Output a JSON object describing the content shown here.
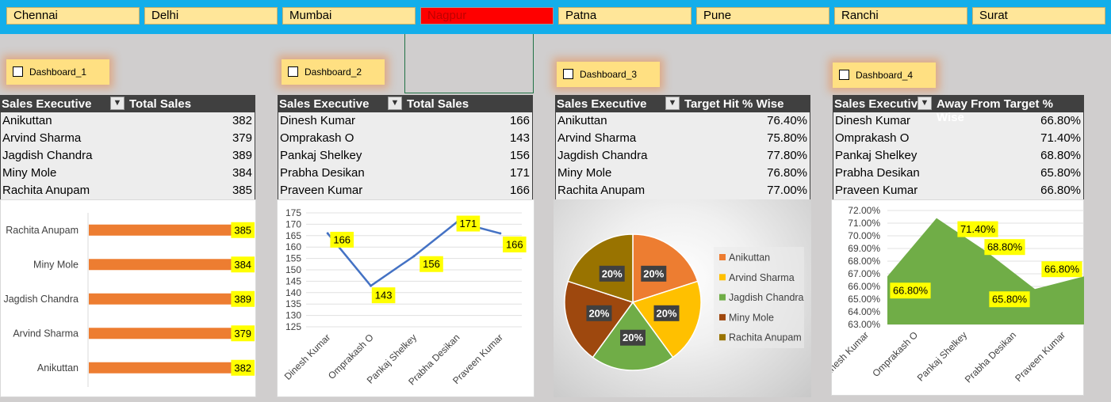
{
  "slicer": {
    "items": [
      "Chennai",
      "Delhi",
      "Mumbai",
      "Nagpur",
      "Patna",
      "Pune",
      "Ranchi",
      "Surat"
    ],
    "selected": "Nagpur"
  },
  "checkboxes": [
    "Dashboard_1",
    "Dashboard_2",
    "Dashboard_3",
    "Dashboard_4"
  ],
  "tables": [
    {
      "col1": "Sales Executive",
      "col2": "Total Sales",
      "rows": [
        [
          "Anikuttan",
          "382"
        ],
        [
          "Arvind Sharma",
          "379"
        ],
        [
          "Jagdish Chandra",
          "389"
        ],
        [
          "Miny Mole",
          "384"
        ],
        [
          "Rachita Anupam",
          "385"
        ]
      ]
    },
    {
      "col1": "Sales Executive",
      "col2": "Total Sales",
      "rows": [
        [
          "Dinesh Kumar",
          "166"
        ],
        [
          "Omprakash O",
          "143"
        ],
        [
          "Pankaj Shelkey",
          "156"
        ],
        [
          "Prabha Desikan",
          "171"
        ],
        [
          "Praveen Kumar",
          "166"
        ]
      ]
    },
    {
      "col1": "Sales Executive",
      "col2": "Target Hit % Wise",
      "rows": [
        [
          "Anikuttan",
          "76.40%"
        ],
        [
          "Arvind Sharma",
          "75.80%"
        ],
        [
          "Jagdish Chandra",
          "77.80%"
        ],
        [
          "Miny Mole",
          "76.80%"
        ],
        [
          "Rachita Anupam",
          "77.00%"
        ]
      ]
    },
    {
      "col1": "Sales Executive",
      "col2": "Away From Target % Wise",
      "rows": [
        [
          "Dinesh Kumar",
          "66.80%"
        ],
        [
          "Omprakash O",
          "71.40%"
        ],
        [
          "Pankaj Shelkey",
          "68.80%"
        ],
        [
          "Prabha Desikan",
          "65.80%"
        ],
        [
          "Praveen Kumar",
          "66.80%"
        ]
      ]
    }
  ],
  "colors": {
    "orange": "#ed7d31",
    "blue": "#4472c4",
    "green": "#70ad47",
    "gold": "#ffc000",
    "rust": "#9e480e",
    "olive": "#997300",
    "label_bg": "#ffff00",
    "header_bg": "#404040"
  },
  "chart_data": [
    {
      "type": "bar",
      "orientation": "horizontal",
      "categories": [
        "Rachita Anupam",
        "Miny Mole",
        "Jagdish Chandra",
        "Arvind Sharma",
        "Anikuttan"
      ],
      "values": [
        385,
        384,
        389,
        379,
        382
      ],
      "data_labels": [
        "385",
        "384",
        "389",
        "379",
        "382"
      ],
      "xlim": [
        0,
        389
      ]
    },
    {
      "type": "line",
      "categories": [
        "Dinesh Kumar",
        "Omprakash O",
        "Pankaj Shelkey",
        "Prabha Desikan",
        "Praveen Kumar"
      ],
      "values": [
        166,
        143,
        156,
        171,
        166
      ],
      "data_labels": [
        "166",
        "143",
        "156",
        "171",
        "166"
      ],
      "ylim": [
        125,
        175
      ],
      "yticks": [
        "175",
        "170",
        "165",
        "160",
        "155",
        "150",
        "145",
        "140",
        "135",
        "130",
        "125"
      ]
    },
    {
      "type": "pie",
      "categories": [
        "Anikuttan",
        "Arvind Sharma",
        "Jagdish Chandra",
        "Miny Mole",
        "Rachita Anupam"
      ],
      "values": [
        20,
        20,
        20,
        20,
        20
      ],
      "data_labels": [
        "20%",
        "20%",
        "20%",
        "20%",
        "20%"
      ],
      "legend": "right"
    },
    {
      "type": "area",
      "categories": [
        "Dinesh Kumar",
        "Omprakash O",
        "Pankaj Shelkey",
        "Prabha Desikan",
        "Praveen Kumar"
      ],
      "values": [
        66.8,
        71.4,
        68.8,
        65.8,
        66.8
      ],
      "data_labels": [
        "66.80%",
        "71.40%",
        "68.80%",
        "65.80%",
        "66.80%"
      ],
      "ylim": [
        63,
        72
      ],
      "yticks": [
        "72.00%",
        "71.00%",
        "70.00%",
        "69.00%",
        "68.00%",
        "67.00%",
        "66.00%",
        "65.00%",
        "64.00%",
        "63.00%"
      ]
    }
  ]
}
